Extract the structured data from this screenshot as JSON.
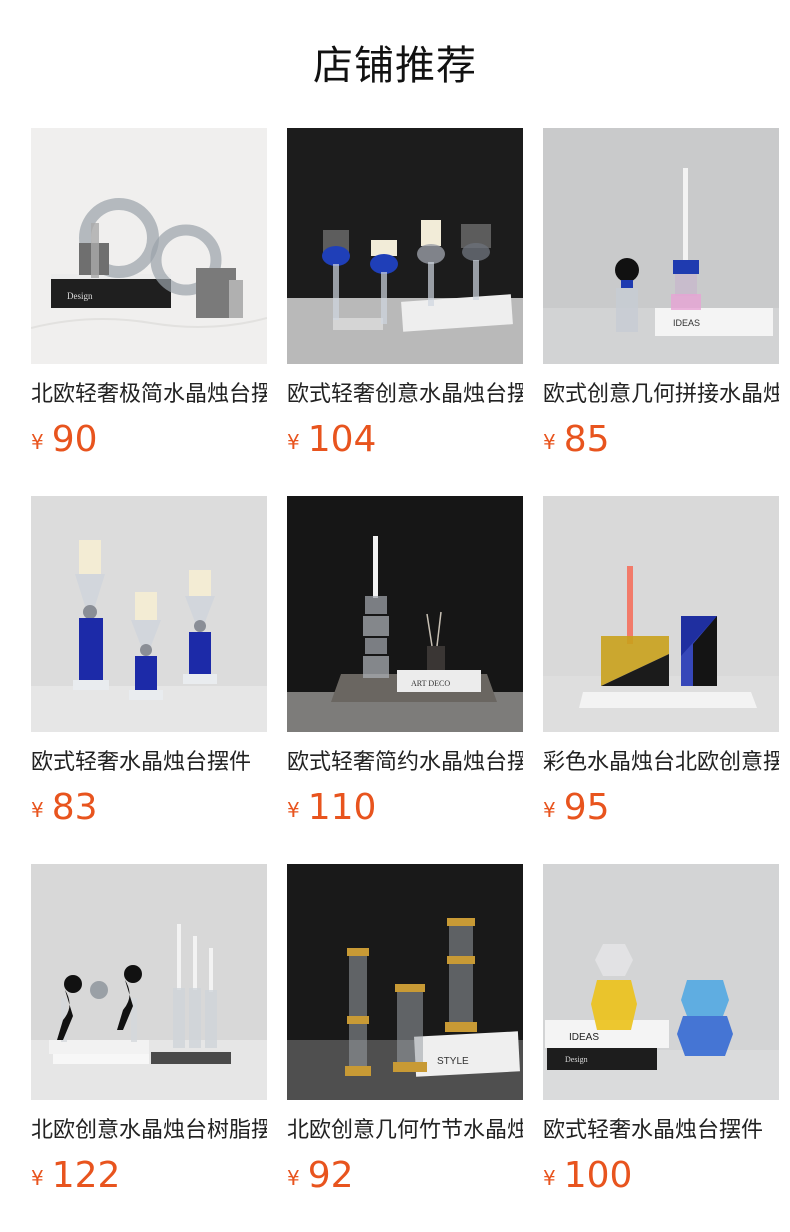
{
  "page": {
    "title": "店铺推荐",
    "accent_color": "#e8541e"
  },
  "products": [
    {
      "name": "北欧轻奢极简水晶烛台摆件",
      "currency": "¥",
      "price": "90",
      "image": "grey-ring-candle-holders-photo"
    },
    {
      "name": "欧式轻奢创意水晶烛台摆件",
      "currency": "¥",
      "price": "104",
      "image": "blue-crystal-cup-candle-holders-photo"
    },
    {
      "name": "欧式创意几何拼接水晶烛台",
      "currency": "¥",
      "price": "85",
      "image": "pink-blue-geometric-candle-holder-photo"
    },
    {
      "name": "欧式轻奢水晶烛台摆件",
      "currency": "¥",
      "price": "83",
      "image": "blue-column-candle-holders-photo"
    },
    {
      "name": "欧式轻奢简约水晶烛台摆件",
      "currency": "¥",
      "price": "110",
      "image": "stacked-crystal-candle-holder-photo"
    },
    {
      "name": "彩色水晶烛台北欧创意摆件",
      "currency": "¥",
      "price": "95",
      "image": "colored-block-candle-holder-photo"
    },
    {
      "name": "北欧创意水晶烛台树脂摆件",
      "currency": "¥",
      "price": "122",
      "image": "thinker-figure-candle-holders-photo"
    },
    {
      "name": "北欧创意几何竹节水晶烛台",
      "currency": "¥",
      "price": "92",
      "image": "bamboo-gold-candle-holders-photo"
    },
    {
      "name": "欧式轻奢水晶烛台摆件",
      "currency": "¥",
      "price": "100",
      "image": "yellow-blue-crystal-candle-holders-photo"
    }
  ]
}
